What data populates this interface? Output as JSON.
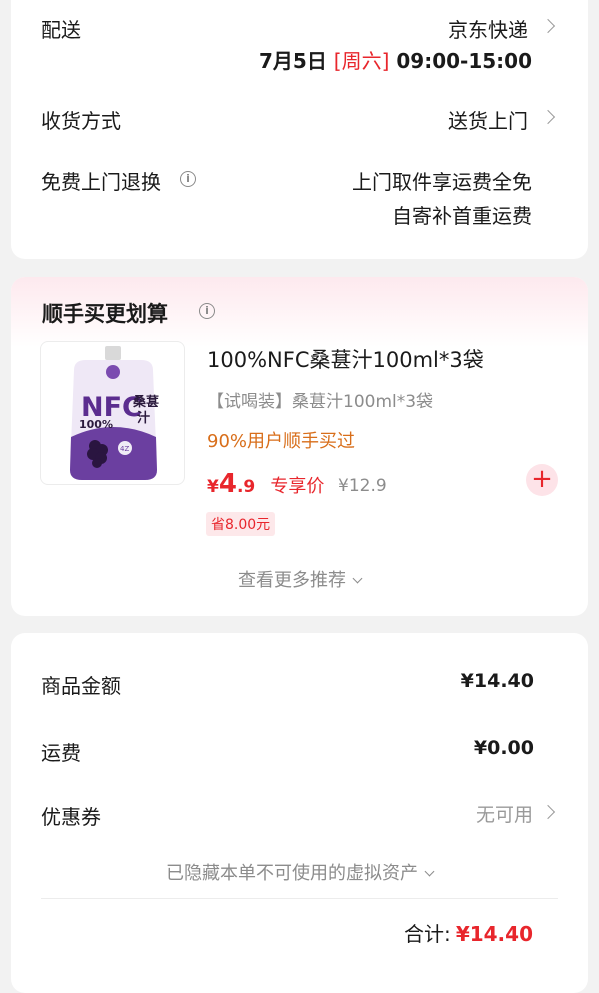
{
  "delivery": {
    "label": "配送",
    "courier": "京东快递",
    "date": "7月5日",
    "weekday": "[周六]",
    "time": "09:00-15:00"
  },
  "receive": {
    "label": "收货方式",
    "value": "送货上门"
  },
  "return_service": {
    "label": "免费上门退换",
    "line1": "上门取件享运费全免",
    "line2": "自寄补首重运费",
    "info_icon": "info-icon"
  },
  "addon": {
    "title": "顺手买更划算",
    "product": {
      "name": "100%NFC桑葚汁100ml*3袋",
      "subtitle": "【试喝装】桑葚汁100ml*3袋",
      "hint": "90%用户顺手买过",
      "price_symbol": "¥",
      "price_int": "4",
      "price_dec": ".9",
      "price_tag": "专享价",
      "original_price": "¥12.9",
      "save": "省8.00元",
      "add_icon": "plus-icon",
      "image": {
        "brand": "NFC",
        "name_line1": "桑葚",
        "name_line2": "汁",
        "percent": "100%",
        "badge": "4Z"
      }
    },
    "more": "查看更多推荐"
  },
  "summary": {
    "goods_label": "商品金额",
    "goods_value": "¥14.40",
    "shipping_label": "运费",
    "shipping_value": "¥0.00",
    "coupon_label": "优惠券",
    "coupon_value": "无可用",
    "hidden_note": "已隐藏本单不可使用的虚拟资产",
    "total_label": "合计:",
    "total_value": "¥14.40"
  },
  "colors": {
    "accent": "#e8262c",
    "hint": "#d86e1a",
    "muted": "#8c8c8c"
  }
}
